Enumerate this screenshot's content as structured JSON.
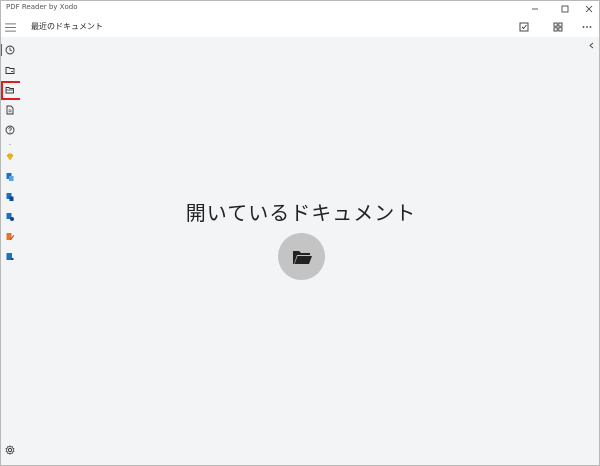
{
  "window": {
    "title": "PDF Reader by Xodo"
  },
  "toolbar": {
    "page_title": "最近のドキュメント"
  },
  "main": {
    "heading": "開いているドキュメント"
  },
  "sidebar": {
    "items": [
      {
        "icon": "clock-icon"
      },
      {
        "icon": "folder-icon"
      },
      {
        "icon": "folder-open-icon"
      },
      {
        "icon": "document-icon"
      },
      {
        "icon": "help-icon"
      },
      {
        "icon": "diamond-icon"
      },
      {
        "icon": "pdf-convert-icon"
      },
      {
        "icon": "pdf-merge-icon"
      },
      {
        "icon": "pdf-split-icon"
      },
      {
        "icon": "pdf-edit-icon"
      },
      {
        "icon": "pdf-sign-icon"
      }
    ],
    "settings_icon": "gear-icon"
  },
  "colors": {
    "accent": "#1f6fbf",
    "highlight": "#e11d1d",
    "background": "#f3f4f6",
    "open_button": "#c4c4c4"
  }
}
